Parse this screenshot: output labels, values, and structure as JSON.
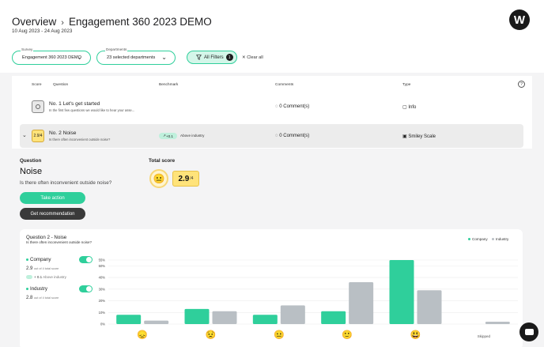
{
  "header": {
    "overview": "Overview",
    "separator": "›",
    "title": "Engagement 360 2023 DEMO",
    "date_range": "10 Aug 2023 - 24 Aug 2023",
    "logo_letter": "W"
  },
  "filters": {
    "survey_label": "Survey",
    "survey_value": "Engagement 360 2023 DEMO",
    "departments_label": "Departments",
    "departments_value": "23 selected departments",
    "all_filters_label": "All Filters",
    "all_filters_count": "1",
    "clear_all_label": "Clear all"
  },
  "table": {
    "headers": {
      "score": "Score",
      "question": "Question",
      "benchmark": "Benchmark",
      "comments": "Comments",
      "type": "Type"
    },
    "rows": [
      {
        "score": "",
        "title": "No. 1 Let's get started",
        "subtitle": "In the first few questions we would like to hear your asse...",
        "benchmark_delta": "",
        "benchmark_label": "",
        "comments": "0 Comment(s)",
        "type": "Info"
      },
      {
        "score": "2.9/4",
        "title": "No. 2 Noise",
        "subtitle": "Is there often inconvenient outside noise?",
        "benchmark_delta": "+0.1",
        "benchmark_label": "Above industry",
        "comments": "0 Comment(s)",
        "type": "Smiley Scale"
      }
    ]
  },
  "detail": {
    "question_label": "Question",
    "question_title": "Noise",
    "question_text": "Is there often inconvenient outside noise?",
    "total_score_label": "Total score",
    "total_score_value": "2.9",
    "total_score_suffix": "/4",
    "take_action_label": "Take action",
    "recommendation_label": "Get recommendation"
  },
  "chart_card": {
    "title": "Question 2 - Noise",
    "subtitle": "Is there often inconvenient outside noise?",
    "legend": {
      "company": "Company",
      "industry": "Industry"
    },
    "company_label": "Company",
    "company_score": "2.9",
    "company_score_suffix": "out of 4 total score",
    "company_bench_delta": "+ 0.1",
    "company_bench_label": "Above industry",
    "industry_label": "Industry",
    "industry_score": "2.8",
    "industry_score_suffix": "out of 4 total score",
    "colors": {
      "company": "#2fcf9b",
      "industry": "#b9bfc4",
      "accent": "#2fcf9b"
    }
  },
  "chart_data": {
    "type": "bar",
    "categories": [
      "😞",
      "😟",
      "😐",
      "🙂",
      "😃",
      "Skipped"
    ],
    "ylim": [
      0,
      55
    ],
    "yticks": [
      "0%",
      "10%",
      "20%",
      "30%",
      "40%",
      "50%",
      "55%"
    ],
    "series": [
      {
        "name": "Company",
        "values": [
          8,
          13,
          8,
          11,
          55,
          0
        ]
      },
      {
        "name": "Industry",
        "values": [
          3,
          11,
          16,
          36,
          29,
          2
        ]
      }
    ]
  }
}
